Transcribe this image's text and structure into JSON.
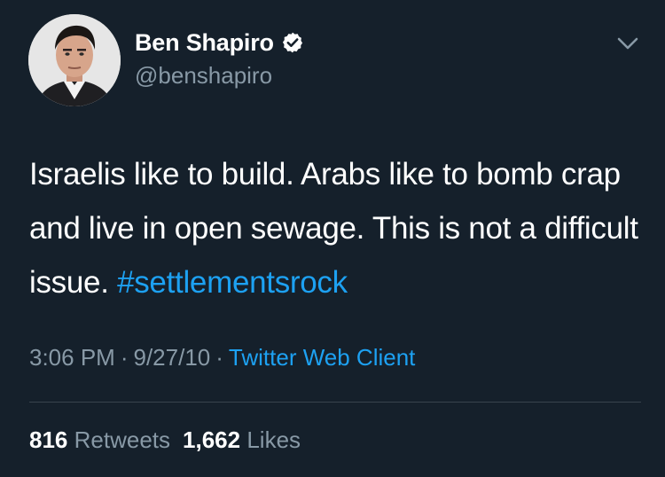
{
  "author": {
    "display_name": "Ben Shapiro",
    "handle": "@benshapiro",
    "verified_icon": "verified-badge-icon"
  },
  "menu": {
    "icon": "chevron-down-icon"
  },
  "tweet": {
    "text_before_hashtag": "Israelis like to build. Arabs like to bomb crap and live in open sewage. This is not a difficult issue. ",
    "hashtag": "#settlementsrock",
    "time": "3:06 PM",
    "date": "9/27/10",
    "separator": "·",
    "client": "Twitter Web Client"
  },
  "stats": {
    "retweets_count": "816",
    "retweets_label": "Retweets",
    "likes_count": "1,662",
    "likes_label": "Likes"
  },
  "colors": {
    "background": "#15202b",
    "primary_text": "#ffffff",
    "secondary_text": "#8899a6",
    "accent": "#1da1f2",
    "divider": "#38444d"
  }
}
